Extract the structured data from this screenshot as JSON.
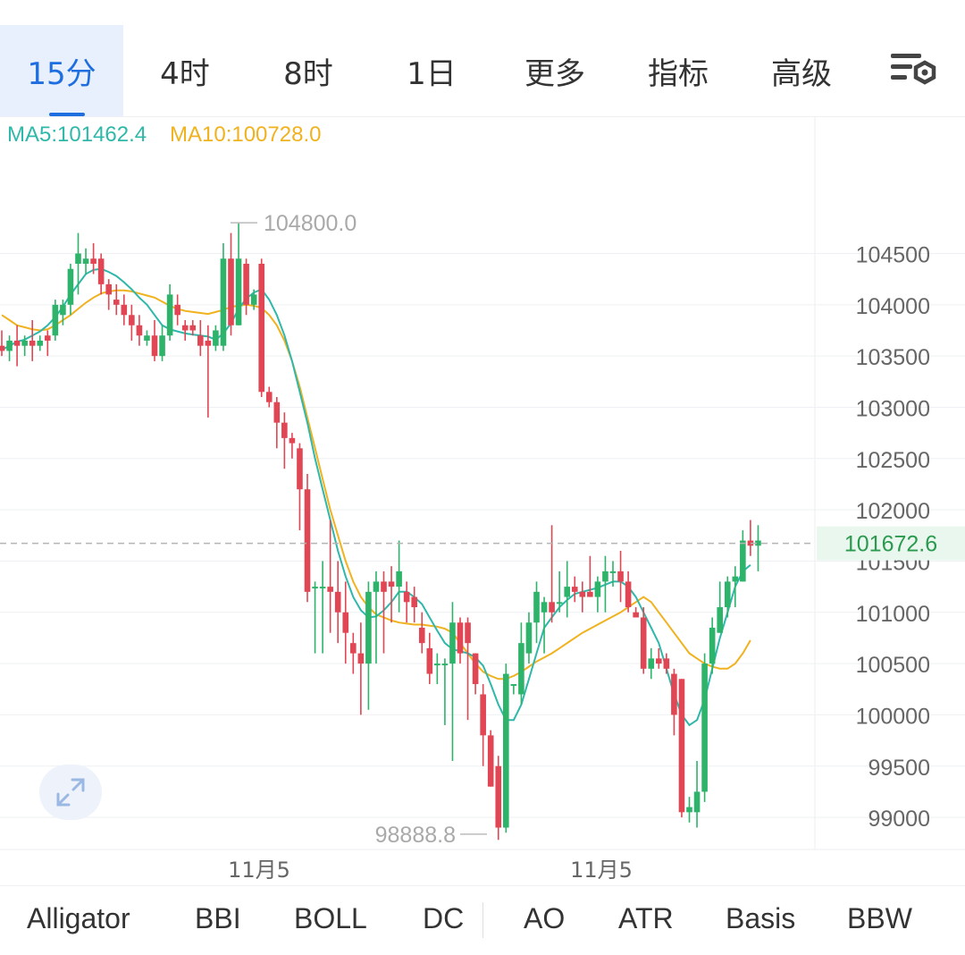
{
  "tabs": [
    {
      "label": "15分",
      "active": true,
      "dropdown": false
    },
    {
      "label": "4时",
      "active": false,
      "dropdown": false
    },
    {
      "label": "8时",
      "active": false,
      "dropdown": false
    },
    {
      "label": "1日",
      "active": false,
      "dropdown": false
    },
    {
      "label": "更多",
      "active": false,
      "dropdown": true
    },
    {
      "label": "指标",
      "active": false,
      "dropdown": true
    },
    {
      "label": "高级",
      "active": false,
      "dropdown": true
    }
  ],
  "settings_icon": "chart-settings-icon",
  "expand_icon": "expand-arrows-icon",
  "bottom_tabs": [
    "Alligator",
    "BBI",
    "BOLL",
    "DC",
    "AO",
    "ATR",
    "Basis",
    "BBW"
  ],
  "colors": {
    "up": "#2db36a",
    "down": "#e04653",
    "ma5": "#2fb8aa",
    "ma10": "#f0b21e",
    "accent": "#1f6ee0",
    "price_tag_bg": "#eaf7ee",
    "price_tag_text": "#2a9a4f"
  },
  "chart_data": {
    "type": "candlestick",
    "indicators": [
      {
        "name": "MA5",
        "value": "101462.4"
      },
      {
        "name": "MA10",
        "value": "100728.0"
      }
    ],
    "y_ticks": [
      "104500",
      "104000",
      "103500",
      "103000",
      "102500",
      "102000",
      "101500",
      "101000",
      "100500",
      "100000",
      "99500",
      "99000"
    ],
    "y_range": [
      98700,
      105200
    ],
    "x_labels": [
      "11月5",
      "11月5"
    ],
    "current_price": "101672.6",
    "high_label": "104800.0",
    "low_label": "98888.8",
    "candles": [
      [
        103600,
        103550,
        103750,
        103500
      ],
      [
        103550,
        103650,
        103700,
        103450
      ],
      [
        103650,
        103600,
        103800,
        103400
      ],
      [
        103600,
        103650,
        103700,
        103500
      ],
      [
        103650,
        103600,
        103850,
        103450
      ],
      [
        103600,
        103650,
        103700,
        103550
      ],
      [
        103700,
        103650,
        103750,
        103500
      ],
      [
        103700,
        104000,
        104050,
        103650
      ],
      [
        103900,
        104000,
        104050,
        103800
      ],
      [
        104000,
        104350,
        104400,
        103900
      ],
      [
        104400,
        104500,
        104700,
        104100
      ],
      [
        104400,
        104450,
        104550,
        104300
      ],
      [
        104450,
        104400,
        104600,
        104300
      ],
      [
        104450,
        104200,
        104500,
        104100
      ],
      [
        104200,
        104100,
        104250,
        103950
      ],
      [
        104050,
        104000,
        104200,
        103900
      ],
      [
        104000,
        103900,
        104100,
        103800
      ],
      [
        103900,
        103800,
        104000,
        103650
      ],
      [
        103800,
        103700,
        103900,
        103600
      ],
      [
        103650,
        103700,
        103750,
        103600
      ],
      [
        103700,
        103500,
        103850,
        103450
      ],
      [
        103500,
        103700,
        103800,
        103450
      ],
      [
        103700,
        104100,
        104200,
        103650
      ],
      [
        104000,
        103900,
        104100,
        103800
      ],
      [
        103800,
        103750,
        103850,
        103650
      ],
      [
        103800,
        103750,
        103850,
        103700
      ],
      [
        103700,
        103600,
        103850,
        103500
      ],
      [
        103650,
        103600,
        103800,
        102900
      ],
      [
        103600,
        103750,
        103800,
        103550
      ],
      [
        103600,
        104450,
        104600,
        103550
      ],
      [
        104450,
        103800,
        104700,
        103700
      ],
      [
        103800,
        104450,
        104800,
        103800
      ],
      [
        104400,
        104000,
        104450,
        103900
      ],
      [
        104000,
        104100,
        104150,
        103950
      ],
      [
        104400,
        103150,
        104450,
        103100
      ],
      [
        103150,
        103050,
        103200,
        103000
      ],
      [
        103050,
        102850,
        103100,
        102600
      ],
      [
        102850,
        102700,
        102950,
        102400
      ],
      [
        102700,
        102650,
        102750,
        102500
      ],
      [
        102600,
        102200,
        102650,
        101800
      ],
      [
        102200,
        101200,
        102350,
        101100
      ],
      [
        101250,
        101250,
        101300,
        100600
      ],
      [
        101250,
        101250,
        101500,
        100600
      ],
      [
        101250,
        101200,
        101900,
        100800
      ],
      [
        101200,
        101000,
        101500,
        100700
      ],
      [
        101000,
        100800,
        101300,
        100500
      ],
      [
        100700,
        100600,
        100800,
        100400
      ],
      [
        100600,
        100500,
        100900,
        100000
      ],
      [
        100500,
        101200,
        101300,
        100050
      ],
      [
        101200,
        101300,
        101400,
        100500
      ],
      [
        101300,
        101200,
        101400,
        100600
      ],
      [
        101300,
        101250,
        101450,
        100900
      ],
      [
        101250,
        101400,
        101700,
        101000
      ],
      [
        101200,
        101100,
        101300,
        100900
      ],
      [
        101150,
        101050,
        101250,
        100900
      ],
      [
        100850,
        100700,
        101000,
        100600
      ],
      [
        100650,
        100400,
        100800,
        100300
      ],
      [
        100500,
        100500,
        100600,
        100300
      ],
      [
        100500,
        100500,
        100550,
        99900
      ],
      [
        100500,
        100900,
        101100,
        99550
      ],
      [
        100900,
        100600,
        100950,
        100500
      ],
      [
        100900,
        100700,
        100950,
        99950
      ],
      [
        100600,
        100300,
        100600,
        100200
      ],
      [
        100200,
        99800,
        100300,
        99500
      ],
      [
        99800,
        99300,
        99850,
        99300
      ],
      [
        99500,
        98900,
        99600,
        98780
      ],
      [
        98900,
        100400,
        100500,
        98850
      ],
      [
        100300,
        100300,
        100300,
        100200
      ],
      [
        100200,
        100700,
        100900,
        100100
      ],
      [
        100600,
        100900,
        101000,
        100500
      ],
      [
        100900,
        101200,
        101300,
        100700
      ],
      [
        101000,
        101100,
        101150,
        100600
      ],
      [
        101100,
        101000,
        101850,
        100900
      ],
      [
        101100,
        101100,
        101400,
        101000
      ],
      [
        101150,
        101250,
        101500,
        100950
      ],
      [
        101250,
        101200,
        101350,
        101100
      ],
      [
        101200,
        101150,
        101300,
        101000
      ],
      [
        101200,
        101150,
        101550,
        101150
      ],
      [
        101150,
        101300,
        101350,
        101000
      ],
      [
        101300,
        101400,
        101550,
        101000
      ],
      [
        101400,
        101400,
        101500,
        101250
      ],
      [
        101400,
        101300,
        101600,
        101100
      ],
      [
        101300,
        101050,
        101400,
        101000
      ],
      [
        101000,
        100950,
        101050,
        100950
      ],
      [
        100950,
        100450,
        101050,
        100400
      ],
      [
        100450,
        100550,
        100650,
        100350
      ],
      [
        100550,
        100500,
        100650,
        100450
      ],
      [
        100550,
        100450,
        100600,
        100400
      ],
      [
        100400,
        100000,
        100450,
        99800
      ],
      [
        100350,
        99050,
        100350,
        99000
      ],
      [
        99050,
        99100,
        99200,
        98950
      ],
      [
        99050,
        99250,
        99550,
        98900
      ],
      [
        99250,
        100500,
        100600,
        99150
      ],
      [
        100500,
        100850,
        100950,
        100400
      ],
      [
        100800,
        101050,
        101300,
        100800
      ],
      [
        101050,
        101300,
        101350,
        100950
      ],
      [
        101300,
        101350,
        101450,
        101050
      ],
      [
        101300,
        101700,
        101800,
        101300
      ],
      [
        101700,
        101650,
        101900,
        101550
      ],
      [
        101650,
        101700,
        101850,
        101400
      ]
    ],
    "ma5": [
      103560,
      103600,
      103640,
      103660,
      103700,
      103740,
      103800,
      103880,
      103980,
      104100,
      104200,
      104300,
      104340,
      104350,
      104320,
      104280,
      104220,
      104150,
      104070,
      104000,
      103900,
      103800,
      103760,
      103740,
      103720,
      103710,
      103700,
      103690,
      103660,
      103720,
      103820,
      103960,
      104060,
      104120,
      104150,
      104050,
      103900,
      103700,
      103450,
      103150,
      102850,
      102500,
      102200,
      101900,
      101600,
      101350,
      101150,
      101020,
      100950,
      100960,
      101020,
      101100,
      101200,
      101200,
      101150,
      101080,
      100950,
      100820,
      100700,
      100640,
      100620,
      100600,
      100560,
      100480,
      100300,
      100100,
      99950,
      99950,
      100100,
      100350,
      100600,
      100850,
      100950,
      101050,
      101120,
      101180,
      101200,
      101220,
      101240,
      101270,
      101300,
      101300,
      101250,
      101150,
      101000,
      100850,
      100700,
      100450,
      100200,
      100000,
      99900,
      99950,
      100150,
      100450,
      100750,
      101000,
      101250,
      101400,
      101462
    ],
    "ma10": [
      103900,
      103850,
      103800,
      103780,
      103760,
      103750,
      103760,
      103800,
      103850,
      103900,
      103960,
      104020,
      104070,
      104110,
      104130,
      104140,
      104140,
      104130,
      104110,
      104090,
      104070,
      104030,
      103990,
      103960,
      103940,
      103930,
      103920,
      103910,
      103930,
      103950,
      103980,
      103990,
      104000,
      103990,
      103970,
      103900,
      103800,
      103650,
      103450,
      103200,
      102900,
      102600,
      102300,
      102000,
      101750,
      101500,
      101300,
      101150,
      101050,
      100980,
      100950,
      100920,
      100900,
      100890,
      100880,
      100880,
      100870,
      100860,
      100840,
      100800,
      100700,
      100600,
      100500,
      100420,
      100380,
      100350,
      100350,
      100380,
      100420,
      100470,
      100520,
      100560,
      100600,
      100650,
      100700,
      100750,
      100800,
      100840,
      100880,
      100920,
      100960,
      101000,
      101050,
      101100,
      101150,
      101100,
      101000,
      100900,
      100800,
      100700,
      100600,
      100550,
      100500,
      100470,
      100450,
      100450,
      100500,
      100600,
      100728
    ]
  }
}
